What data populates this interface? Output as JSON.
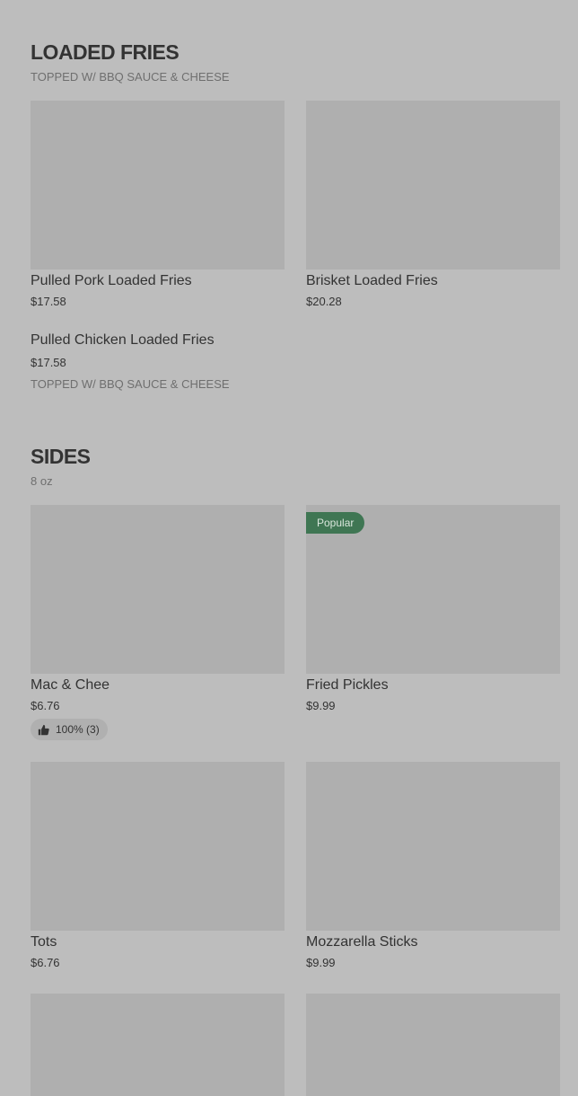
{
  "loaded_fries": {
    "title": "LOADED FRIES",
    "subtitle": "TOPPED W/ BBQ SAUCE & CHEESE",
    "items": [
      {
        "name": "Pulled Pork Loaded Fries",
        "price": "$17.58"
      },
      {
        "name": "Brisket Loaded Fries",
        "price": "$20.28"
      },
      {
        "name": "Pulled Chicken Loaded Fries",
        "price": "$17.58",
        "description": "TOPPED W/ BBQ SAUCE & CHEESE"
      }
    ]
  },
  "sides": {
    "title": "SIDES",
    "subtitle": "8 oz",
    "items": [
      {
        "name": "Mac & Chee",
        "price": "$6.76",
        "rating": "100% (3)",
        "rating_icon": "thumbs-up-icon"
      },
      {
        "name": "Fried Pickles",
        "price": "$9.99",
        "badge": "Popular"
      },
      {
        "name": "Tots",
        "price": "$6.76"
      },
      {
        "name": "Mozzarella Sticks",
        "price": "$9.99"
      }
    ]
  },
  "colors": {
    "background": "#bdbdbd",
    "image_placeholder": "#afafaf",
    "popular_badge": "#3f7653"
  }
}
